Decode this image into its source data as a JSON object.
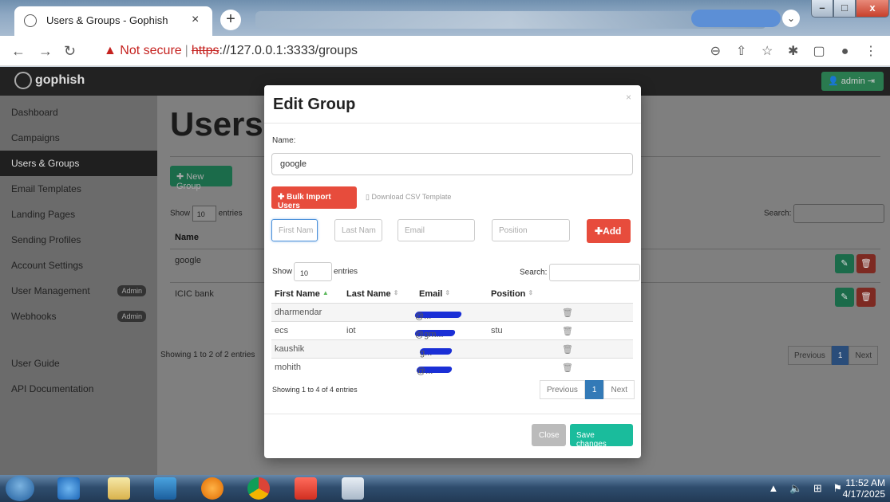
{
  "browser": {
    "tab_title": "Users & Groups - Gophish",
    "tab_close": "×",
    "new_tab": "+",
    "not_secure": "Not secure",
    "url_scheme": "https",
    "url_rest": "://127.0.0.1:3333/groups",
    "win_min": "–",
    "win_max": "□",
    "win_close": "x"
  },
  "app": {
    "brand": "gophish",
    "admin_label": "admin",
    "page_title": "Users",
    "new_group_label": "New Group",
    "bg_show": "Show",
    "bg_show_value": "10",
    "bg_entries": "entries",
    "bg_search": "Search:",
    "bg_col_name": "Name",
    "bg_rows": [
      "google",
      "ICIC bank"
    ],
    "bg_showing": "Showing 1 to 2 of 2 entries",
    "bg_prev": "Previous",
    "bg_page": "1",
    "bg_next": "Next"
  },
  "sidebar": {
    "items": [
      {
        "label": "Dashboard"
      },
      {
        "label": "Campaigns"
      },
      {
        "label": "Users & Groups"
      },
      {
        "label": "Email Templates"
      },
      {
        "label": "Landing Pages"
      },
      {
        "label": "Sending Profiles"
      },
      {
        "label": "Account Settings"
      },
      {
        "label": "User Management",
        "badge": "Admin"
      },
      {
        "label": "Webhooks",
        "badge": "Admin"
      }
    ],
    "bottom_items": [
      {
        "label": "User Guide"
      },
      {
        "label": "API Documentation"
      }
    ]
  },
  "modal": {
    "title": "Edit Group",
    "close": "×",
    "name_label": "Name:",
    "name_value": "google",
    "bulk_import_label": "Bulk Import Users",
    "download_csv_label": "Download CSV Template",
    "first_name_placeholder": "First Nam",
    "last_name_placeholder": "Last Nam",
    "email_placeholder": "Email",
    "position_placeholder": "Position",
    "add_label": "Add",
    "show_label": "Show",
    "show_value": "10",
    "entries_label": "entries",
    "search_label": "Search:",
    "columns": [
      "First Name",
      "Last Name",
      "Email",
      "Position"
    ],
    "rows": [
      {
        "first": "dharmendar",
        "last": "",
        "email": "@...",
        "position": ""
      },
      {
        "first": "ecs",
        "last": "iot",
        "email": "@gm...",
        "position": "stu"
      },
      {
        "first": "kaushik",
        "last": "",
        "email": "g...",
        "position": ""
      },
      {
        "first": "mohith",
        "last": "",
        "email": "@...",
        "position": ""
      }
    ],
    "showing": "Showing 1 to 4 of 4 entries",
    "prev": "Previous",
    "page": "1",
    "next": "Next",
    "close_label": "Close",
    "save_label": "Save changes"
  },
  "taskbar": {
    "time": "11:52 AM",
    "date": "4/17/2025"
  }
}
